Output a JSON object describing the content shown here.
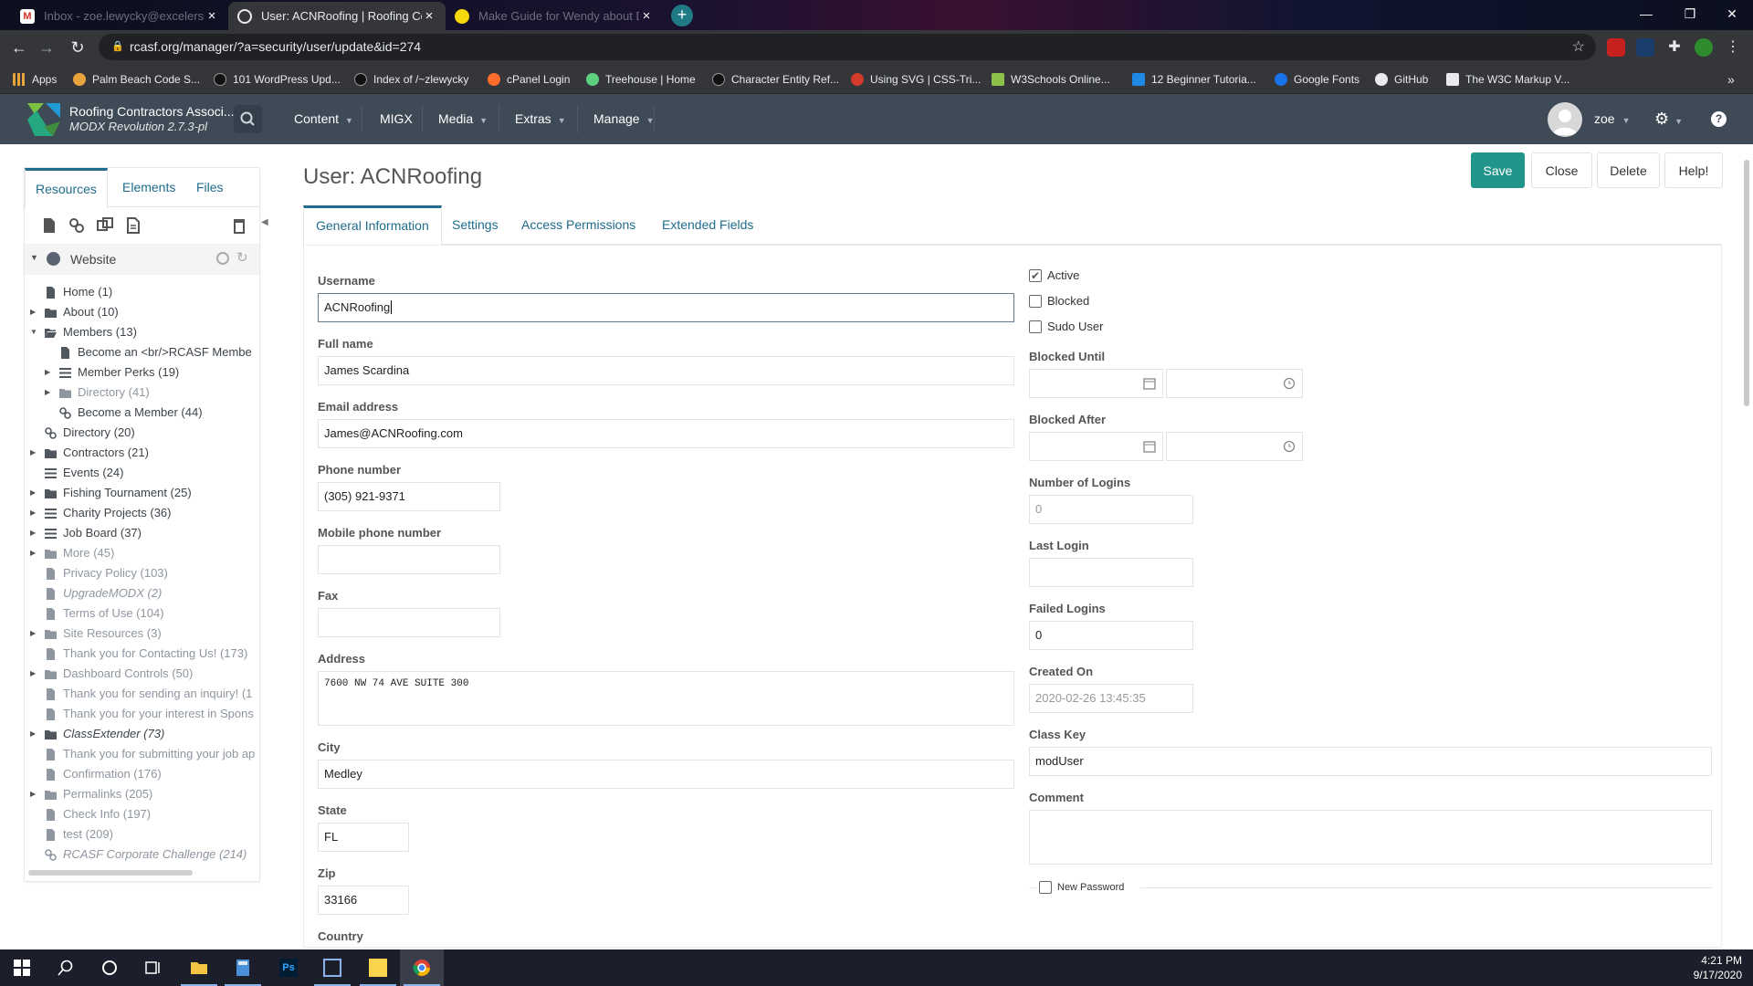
{
  "browser": {
    "tabs": [
      {
        "label": "Inbox - zoe.lewycky@excelersite...",
        "active": false
      },
      {
        "label": "User: ACNRoofing | Roofing Cont...",
        "active": true
      },
      {
        "label": "Make Guide for Wendy about Do...",
        "active": false
      }
    ],
    "url": "rcasf.org/manager/?a=security/user/update&id=274",
    "bookmarks": [
      "Apps",
      "Palm Beach Code S...",
      "101 WordPress Upd...",
      "Index of /~zlewycky",
      "cPanel Login",
      "Treehouse | Home",
      "Character Entity Ref...",
      "Using SVG | CSS-Tri...",
      "W3Schools Online...",
      "12 Beginner Tutoria...",
      "Google Fonts",
      "GitHub",
      "The W3C Markup V..."
    ]
  },
  "header": {
    "site_name": "Roofing Contractors Associ...",
    "version": "MODX Revolution 2.7.3-pl",
    "nav": [
      "Content",
      "MIGX",
      "Media",
      "Extras",
      "Manage"
    ],
    "username": "zoe"
  },
  "left": {
    "tabs": [
      "Resources",
      "Elements",
      "Files"
    ],
    "root": "Website",
    "tree": [
      {
        "label": "Home (1)",
        "depth": 0,
        "icon": "page",
        "arrow": false,
        "style": "normal"
      },
      {
        "label": "About (10)",
        "depth": 0,
        "icon": "folder",
        "arrow": true,
        "style": "normal"
      },
      {
        "label": "Members (13)",
        "depth": 0,
        "icon": "folder-open",
        "arrow": "open",
        "style": "normal"
      },
      {
        "label": "Become an <br/>RCASF Membe",
        "depth": 1,
        "icon": "page",
        "arrow": false,
        "style": "normal"
      },
      {
        "label": "Member Perks (19)",
        "depth": 1,
        "icon": "list",
        "arrow": true,
        "style": "normal"
      },
      {
        "label": "Directory (41)",
        "depth": 1,
        "icon": "folder",
        "arrow": true,
        "style": "dim"
      },
      {
        "label": "Become a Member (44)",
        "depth": 1,
        "icon": "link",
        "arrow": false,
        "style": "normal"
      },
      {
        "label": "Directory (20)",
        "depth": 0,
        "icon": "link",
        "arrow": false,
        "style": "normal"
      },
      {
        "label": "Contractors (21)",
        "depth": 0,
        "icon": "folder",
        "arrow": true,
        "style": "normal"
      },
      {
        "label": "Events (24)",
        "depth": 0,
        "icon": "list",
        "arrow": false,
        "style": "normal"
      },
      {
        "label": "Fishing Tournament (25)",
        "depth": 0,
        "icon": "folder",
        "arrow": true,
        "style": "normal"
      },
      {
        "label": "Charity Projects (36)",
        "depth": 0,
        "icon": "list",
        "arrow": true,
        "style": "normal"
      },
      {
        "label": "Job Board (37)",
        "depth": 0,
        "icon": "list",
        "arrow": true,
        "style": "normal"
      },
      {
        "label": "More (45)",
        "depth": 0,
        "icon": "folder",
        "arrow": true,
        "style": "dim"
      },
      {
        "label": "Privacy Policy (103)",
        "depth": 0,
        "icon": "page",
        "arrow": false,
        "style": "dim"
      },
      {
        "label": "UpgradeMODX (2)",
        "depth": 0,
        "icon": "page",
        "arrow": false,
        "style": "dim-italic"
      },
      {
        "label": "Terms of Use (104)",
        "depth": 0,
        "icon": "page",
        "arrow": false,
        "style": "dim"
      },
      {
        "label": "Site Resources (3)",
        "depth": 0,
        "icon": "folder",
        "arrow": true,
        "style": "dim"
      },
      {
        "label": "Thank you for Contacting Us! (173)",
        "depth": 0,
        "icon": "page",
        "arrow": false,
        "style": "dim"
      },
      {
        "label": "Dashboard Controls (50)",
        "depth": 0,
        "icon": "folder",
        "arrow": true,
        "style": "dim"
      },
      {
        "label": "Thank you for sending an inquiry! (1",
        "depth": 0,
        "icon": "page",
        "arrow": false,
        "style": "dim"
      },
      {
        "label": "Thank you for your interest in Spons",
        "depth": 0,
        "icon": "page",
        "arrow": false,
        "style": "dim"
      },
      {
        "label": "ClassExtender (73)",
        "depth": 0,
        "icon": "folder",
        "arrow": true,
        "style": "italic"
      },
      {
        "label": "Thank you for submitting your job ap",
        "depth": 0,
        "icon": "page",
        "arrow": false,
        "style": "dim"
      },
      {
        "label": "Confirmation (176)",
        "depth": 0,
        "icon": "page",
        "arrow": false,
        "style": "dim"
      },
      {
        "label": "Permalinks (205)",
        "depth": 0,
        "icon": "folder",
        "arrow": true,
        "style": "dim"
      },
      {
        "label": "Check Info (197)",
        "depth": 0,
        "icon": "page",
        "arrow": false,
        "style": "dim"
      },
      {
        "label": "test (209)",
        "depth": 0,
        "icon": "page",
        "arrow": false,
        "style": "dim"
      },
      {
        "label": "RCASF Corporate Challenge (214)",
        "depth": 0,
        "icon": "link",
        "arrow": false,
        "style": "dim-italic"
      }
    ]
  },
  "main": {
    "title": "User: ACNRoofing",
    "buttons": {
      "save": "Save",
      "close": "Close",
      "delete": "Delete",
      "help": "Help!"
    },
    "tabs": [
      "General Information",
      "Settings",
      "Access Permissions",
      "Extended Fields"
    ],
    "form": {
      "username_label": "Username",
      "username": "ACNRoofing",
      "fullname_label": "Full name",
      "fullname": "James Scardina",
      "email_label": "Email address",
      "email": "James@ACNRoofing.com",
      "phone_label": "Phone number",
      "phone": "(305) 921-9371",
      "mobile_label": "Mobile phone number",
      "mobile": "",
      "fax_label": "Fax",
      "fax": "",
      "address_label": "Address",
      "address": "7600 NW 74 AVE SUITE 300",
      "city_label": "City",
      "city": "Medley",
      "state_label": "State",
      "state": "FL",
      "zip_label": "Zip",
      "zip": "33166",
      "country_label": "Country"
    },
    "side": {
      "active_label": "Active",
      "active": true,
      "blocked_label": "Blocked",
      "blocked": false,
      "sudo_label": "Sudo User",
      "sudo": false,
      "blocked_until_label": "Blocked Until",
      "blocked_after_label": "Blocked After",
      "logins_label": "Number of Logins",
      "logins": "0",
      "last_login_label": "Last Login",
      "last_login": "",
      "failed_label": "Failed Logins",
      "failed": "0",
      "created_label": "Created On",
      "created": "2020-02-26 13:45:35",
      "classkey_label": "Class Key",
      "classkey": "modUser",
      "comment_label": "Comment",
      "comment": "",
      "newpw_label": "New Password",
      "newpw": false
    }
  },
  "taskbar": {
    "time": "4:21 PM",
    "date": "9/17/2020"
  }
}
